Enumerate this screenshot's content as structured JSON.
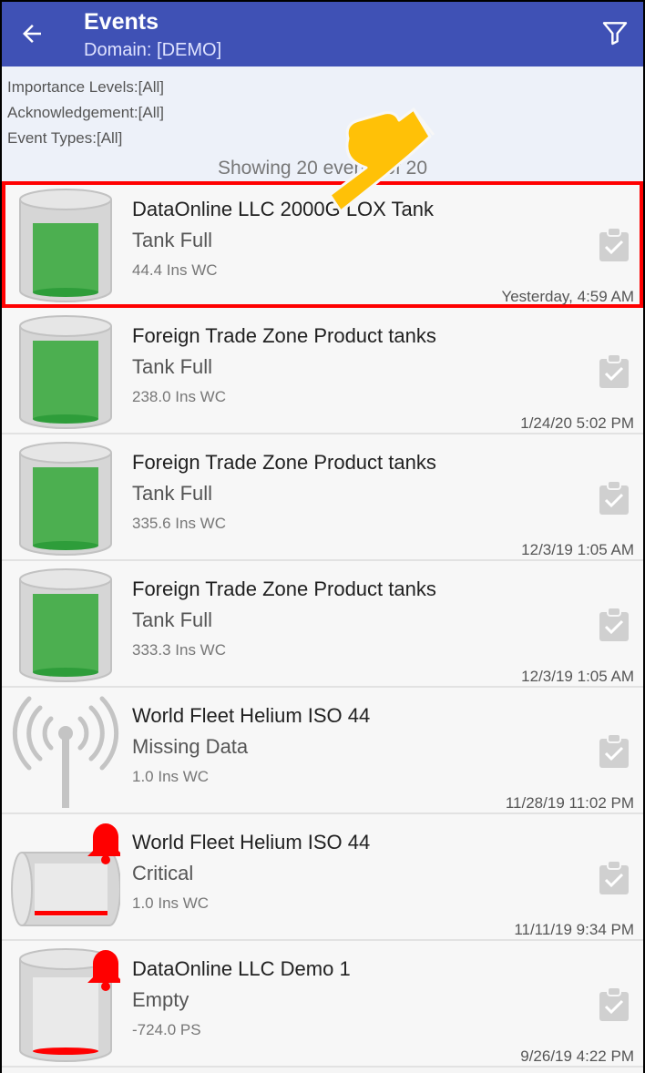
{
  "appbar": {
    "title": "Events",
    "subtitle": "Domain: [DEMO]",
    "back_icon": "arrow-left-icon",
    "filter_icon": "funnel-icon"
  },
  "filters": {
    "importance": "Importance Levels:[All]",
    "acknowledgement": "Acknowledgement:[All]",
    "event_types": "Event Types:[All]",
    "showing": "Showing 20 events of 20"
  },
  "events": [
    {
      "name": "DataOnline LLC 2000G LOX Tank",
      "type": "Tank Full",
      "value": "44.4 Ins WC",
      "time": "Yesterday, 4:59 AM",
      "icon": "tank-full-icon",
      "highlighted": true
    },
    {
      "name": "Foreign Trade Zone Product tanks",
      "type": "Tank Full",
      "value": "238.0 Ins WC",
      "time": "1/24/20 5:02 PM",
      "icon": "tank-full-icon"
    },
    {
      "name": "Foreign Trade Zone Product tanks",
      "type": "Tank Full",
      "value": "335.6 Ins WC",
      "time": "12/3/19 1:05 AM",
      "icon": "tank-full-icon"
    },
    {
      "name": "Foreign Trade Zone Product tanks",
      "type": "Tank Full",
      "value": "333.3 Ins WC",
      "time": "12/3/19 1:05 AM",
      "icon": "tank-full-icon"
    },
    {
      "name": "World Fleet Helium ISO 44",
      "type": "Missing Data",
      "value": "1.0 Ins WC",
      "time": "11/28/19 11:02 PM",
      "icon": "antenna-signal-icon"
    },
    {
      "name": "World Fleet Helium ISO 44",
      "type": "Critical",
      "value": "1.0 Ins WC",
      "time": "11/11/19 9:34 PM",
      "icon": "horizontal-tank-alarm-icon"
    },
    {
      "name": "DataOnline LLC Demo 1",
      "type": "Empty",
      "value": "-724.0 PS",
      "time": "9/26/19 4:22 PM",
      "icon": "tank-empty-alarm-icon"
    }
  ],
  "colors": {
    "appbar": "#3f51b5",
    "tank_fill": "#4caf50",
    "alarm": "#ff0000",
    "highlight": "#ff0000",
    "pointer": "#ffc107"
  }
}
